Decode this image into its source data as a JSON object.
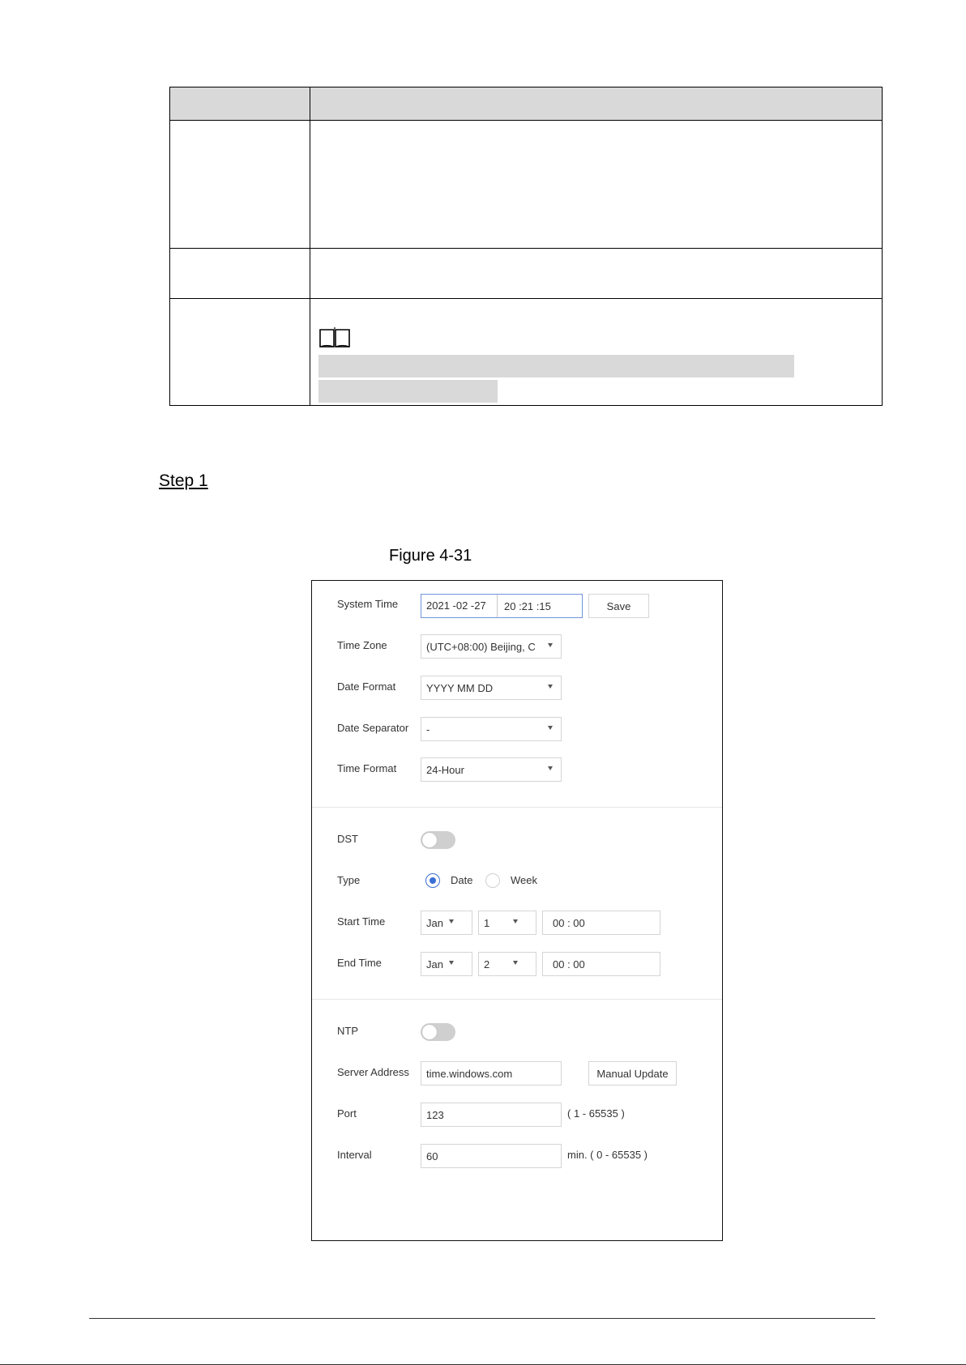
{
  "step": {
    "label": "Step 1"
  },
  "caption": {
    "text": "Figure 4-31"
  },
  "ui": {
    "system_time": {
      "label": "System Time",
      "date": "2021 -02 -27",
      "time": "20 :21 :15",
      "save": "Save"
    },
    "time_zone": {
      "label": "Time Zone",
      "value": "(UTC+08:00) Beijing, C"
    },
    "date_format": {
      "label": "Date Format",
      "value": "YYYY MM DD"
    },
    "date_separator": {
      "label": "Date Separator",
      "value": "-"
    },
    "time_format": {
      "label": "Time Format",
      "value": "24-Hour"
    },
    "dst": {
      "label": "DST",
      "enabled": false
    },
    "type": {
      "label": "Type",
      "option_date": "Date",
      "option_week": "Week",
      "selected": "Date"
    },
    "start_time": {
      "label": "Start Time",
      "month": "Jan",
      "day": "1",
      "time": "00 :  00"
    },
    "end_time": {
      "label": "End Time",
      "month": "Jan",
      "day": "2",
      "time": "00 :  00"
    },
    "ntp": {
      "label": "NTP",
      "enabled": false
    },
    "server_address": {
      "label": "Server Address",
      "value": "time.windows.com",
      "button": "Manual Update"
    },
    "port": {
      "label": "Port",
      "value": "123",
      "hint": "( 1 - 65535 )"
    },
    "interval": {
      "label": "Interval",
      "value": "60",
      "hint": "min. ( 0 - 65535 )"
    }
  },
  "colors": {
    "accent": "#3b6fd8",
    "table_header": "#d9d9d9",
    "toggle_off": "#cfcfcf"
  },
  "icons": {
    "note": "book-icon"
  }
}
